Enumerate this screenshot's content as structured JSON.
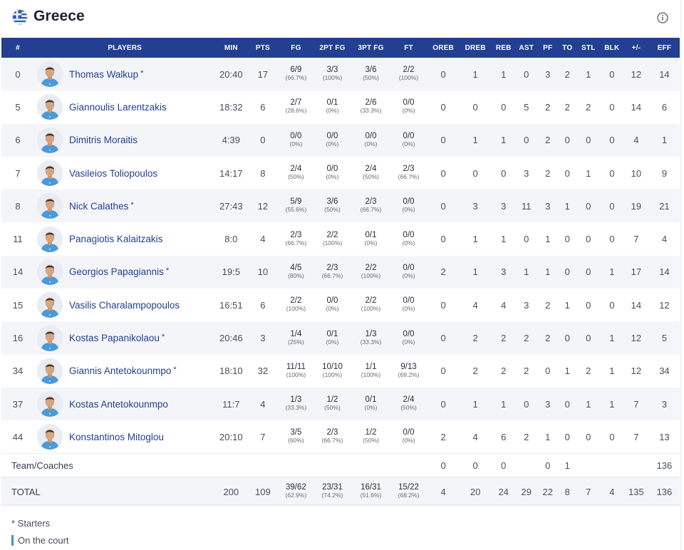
{
  "team": {
    "name": "Greece",
    "flag_icon": "greece-flag-icon",
    "info_icon": "info-icon"
  },
  "columns": [
    "#",
    "PLAYERS",
    "MIN",
    "PTS",
    "FG",
    "2PT FG",
    "3PT FG",
    "FT",
    "OREB",
    "DREB",
    "REB",
    "AST",
    "PF",
    "TO",
    "STL",
    "BLK",
    "+/-",
    "EFF"
  ],
  "players": [
    {
      "no": "0",
      "name": "Thomas Walkup",
      "starter": "*",
      "min": "20:40",
      "pts": "17",
      "fg": "6/9",
      "fg_pct": "(66.7%)",
      "p2": "3/3",
      "p2_pct": "(100%)",
      "p3": "3/6",
      "p3_pct": "(50%)",
      "ft": "2/2",
      "ft_pct": "(100%)",
      "oreb": "0",
      "dreb": "1",
      "reb": "1",
      "ast": "0",
      "pf": "3",
      "to": "2",
      "stl": "1",
      "blk": "0",
      "pm": "12",
      "eff": "14"
    },
    {
      "no": "5",
      "name": "Giannoulis Larentzakis",
      "starter": "",
      "min": "18:32",
      "pts": "6",
      "fg": "2/7",
      "fg_pct": "(28.6%)",
      "p2": "0/1",
      "p2_pct": "(0%)",
      "p3": "2/6",
      "p3_pct": "(33.3%)",
      "ft": "0/0",
      "ft_pct": "(0%)",
      "oreb": "0",
      "dreb": "0",
      "reb": "0",
      "ast": "5",
      "pf": "2",
      "to": "2",
      "stl": "2",
      "blk": "0",
      "pm": "14",
      "eff": "6"
    },
    {
      "no": "6",
      "name": "Dimitris Moraitis",
      "starter": "",
      "min": "4:39",
      "pts": "0",
      "fg": "0/0",
      "fg_pct": "(0%)",
      "p2": "0/0",
      "p2_pct": "(0%)",
      "p3": "0/0",
      "p3_pct": "(0%)",
      "ft": "0/0",
      "ft_pct": "(0%)",
      "oreb": "0",
      "dreb": "1",
      "reb": "1",
      "ast": "0",
      "pf": "2",
      "to": "0",
      "stl": "0",
      "blk": "0",
      "pm": "4",
      "eff": "1"
    },
    {
      "no": "7",
      "name": "Vasileios Toliopoulos",
      "starter": "",
      "min": "14:17",
      "pts": "8",
      "fg": "2/4",
      "fg_pct": "(50%)",
      "p2": "0/0",
      "p2_pct": "(0%)",
      "p3": "2/4",
      "p3_pct": "(50%)",
      "ft": "2/3",
      "ft_pct": "(66.7%)",
      "oreb": "0",
      "dreb": "0",
      "reb": "0",
      "ast": "3",
      "pf": "2",
      "to": "0",
      "stl": "1",
      "blk": "0",
      "pm": "10",
      "eff": "9"
    },
    {
      "no": "8",
      "name": "Nick Calathes",
      "starter": "*",
      "min": "27:43",
      "pts": "12",
      "fg": "5/9",
      "fg_pct": "(55.6%)",
      "p2": "3/6",
      "p2_pct": "(50%)",
      "p3": "2/3",
      "p3_pct": "(66.7%)",
      "ft": "0/0",
      "ft_pct": "(0%)",
      "oreb": "0",
      "dreb": "3",
      "reb": "3",
      "ast": "11",
      "pf": "3",
      "to": "1",
      "stl": "0",
      "blk": "0",
      "pm": "19",
      "eff": "21"
    },
    {
      "no": "11",
      "name": "Panagiotis Kalaitzakis",
      "starter": "",
      "min": "8:0",
      "pts": "4",
      "fg": "2/3",
      "fg_pct": "(66.7%)",
      "p2": "2/2",
      "p2_pct": "(100%)",
      "p3": "0/1",
      "p3_pct": "(0%)",
      "ft": "0/0",
      "ft_pct": "(0%)",
      "oreb": "0",
      "dreb": "1",
      "reb": "1",
      "ast": "0",
      "pf": "1",
      "to": "0",
      "stl": "0",
      "blk": "0",
      "pm": "7",
      "eff": "4"
    },
    {
      "no": "14",
      "name": "Georgios Papagiannis",
      "starter": "*",
      "min": "19:5",
      "pts": "10",
      "fg": "4/5",
      "fg_pct": "(80%)",
      "p2": "2/3",
      "p2_pct": "(66.7%)",
      "p3": "2/2",
      "p3_pct": "(100%)",
      "ft": "0/0",
      "ft_pct": "(0%)",
      "oreb": "2",
      "dreb": "1",
      "reb": "3",
      "ast": "1",
      "pf": "1",
      "to": "0",
      "stl": "0",
      "blk": "1",
      "pm": "17",
      "eff": "14"
    },
    {
      "no": "15",
      "name": "Vasilis Charalampopoulos",
      "starter": "",
      "min": "16:51",
      "pts": "6",
      "fg": "2/2",
      "fg_pct": "(100%)",
      "p2": "0/0",
      "p2_pct": "(0%)",
      "p3": "2/2",
      "p3_pct": "(100%)",
      "ft": "0/0",
      "ft_pct": "(0%)",
      "oreb": "0",
      "dreb": "4",
      "reb": "4",
      "ast": "3",
      "pf": "2",
      "to": "1",
      "stl": "0",
      "blk": "0",
      "pm": "14",
      "eff": "12"
    },
    {
      "no": "16",
      "name": "Kostas Papanikolaou",
      "starter": "*",
      "min": "20:46",
      "pts": "3",
      "fg": "1/4",
      "fg_pct": "(25%)",
      "p2": "0/1",
      "p2_pct": "(0%)",
      "p3": "1/3",
      "p3_pct": "(33.3%)",
      "ft": "0/0",
      "ft_pct": "(0%)",
      "oreb": "0",
      "dreb": "2",
      "reb": "2",
      "ast": "2",
      "pf": "2",
      "to": "0",
      "stl": "0",
      "blk": "1",
      "pm": "12",
      "eff": "5"
    },
    {
      "no": "34",
      "name": "Giannis Antetokounmpo",
      "starter": "*",
      "min": "18:10",
      "pts": "32",
      "fg": "11/11",
      "fg_pct": "(100%)",
      "p2": "10/10",
      "p2_pct": "(100%)",
      "p3": "1/1",
      "p3_pct": "(100%)",
      "ft": "9/13",
      "ft_pct": "(69.2%)",
      "oreb": "0",
      "dreb": "2",
      "reb": "2",
      "ast": "2",
      "pf": "0",
      "to": "1",
      "stl": "2",
      "blk": "1",
      "pm": "12",
      "eff": "34"
    },
    {
      "no": "37",
      "name": "Kostas Antetokounmpo",
      "starter": "",
      "min": "11:7",
      "pts": "4",
      "fg": "1/3",
      "fg_pct": "(33.3%)",
      "p2": "1/2",
      "p2_pct": "(50%)",
      "p3": "0/1",
      "p3_pct": "(0%)",
      "ft": "2/4",
      "ft_pct": "(50%)",
      "oreb": "0",
      "dreb": "1",
      "reb": "1",
      "ast": "0",
      "pf": "3",
      "to": "0",
      "stl": "1",
      "blk": "1",
      "pm": "7",
      "eff": "3"
    },
    {
      "no": "44",
      "name": "Konstantinos Mitoglou",
      "starter": "",
      "min": "20:10",
      "pts": "7",
      "fg": "3/5",
      "fg_pct": "(60%)",
      "p2": "2/3",
      "p2_pct": "(66.7%)",
      "p3": "1/2",
      "p3_pct": "(50%)",
      "ft": "0/0",
      "ft_pct": "(0%)",
      "oreb": "2",
      "dreb": "4",
      "reb": "6",
      "ast": "2",
      "pf": "1",
      "to": "0",
      "stl": "0",
      "blk": "0",
      "pm": "7",
      "eff": "13"
    }
  ],
  "team_coaches": {
    "label": "Team/Coaches",
    "oreb": "0",
    "dreb": "0",
    "reb": "0",
    "pf": "0",
    "to": "1",
    "eff": "136"
  },
  "total": {
    "label": "TOTAL",
    "min": "200",
    "pts": "109",
    "fg": "39/62",
    "fg_pct": "(62.9%)",
    "p2": "23/31",
    "p2_pct": "(74.2%)",
    "p3": "16/31",
    "p3_pct": "(51.6%)",
    "ft": "15/22",
    "ft_pct": "(68.2%)",
    "oreb": "4",
    "dreb": "20",
    "reb": "24",
    "ast": "29",
    "pf": "22",
    "to": "8",
    "stl": "7",
    "blk": "4",
    "pm": "135",
    "eff": "136"
  },
  "legend": {
    "starters": "* Starters",
    "on_court": "On the court",
    "on_court_color": "#3b8fe6"
  },
  "colors": {
    "header_bg": "#233f92",
    "player_name": "#233f92"
  }
}
